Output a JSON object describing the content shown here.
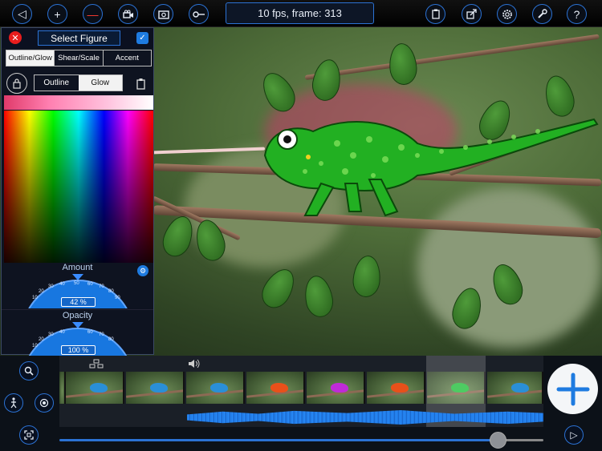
{
  "toolbar": {
    "status": "10 fps, frame: 313",
    "buttons": [
      "back-icon",
      "add-icon",
      "remove-icon",
      "camera-icon",
      "photo-icon",
      "key-icon",
      "clipboard-icon",
      "export-icon",
      "settings-icon",
      "wrench-icon",
      "help-icon"
    ],
    "help_glyph": "?"
  },
  "panel": {
    "title": "Select Figure",
    "tabs": [
      {
        "label": "Outline/Glow",
        "selected": true
      },
      {
        "label": "Shear/Scale",
        "selected": false
      },
      {
        "label": "Accent",
        "selected": false
      }
    ],
    "mode": [
      {
        "label": "Outline",
        "selected": false
      },
      {
        "label": "Glow",
        "selected": true
      }
    ],
    "amount": {
      "label": "Amount",
      "value": "42 %"
    },
    "opacity": {
      "label": "Opacity",
      "value": "100 %"
    },
    "dial_ticks": [
      "10",
      "20",
      "30",
      "40",
      "50",
      "60",
      "70",
      "80",
      "90"
    ]
  },
  "colors": {
    "accent": "#2b72d4",
    "glow": "#e8306a",
    "close": "#e81d1d"
  },
  "timeline": {
    "selected_frame_index": 6,
    "frame_chameleon_colors": [
      "#2a8fd8",
      "#2a8fd8",
      "#2a8fd8",
      "#e8501a",
      "#c02ad8",
      "#e8501a",
      "#28c040",
      "#2a8fd8"
    ]
  }
}
